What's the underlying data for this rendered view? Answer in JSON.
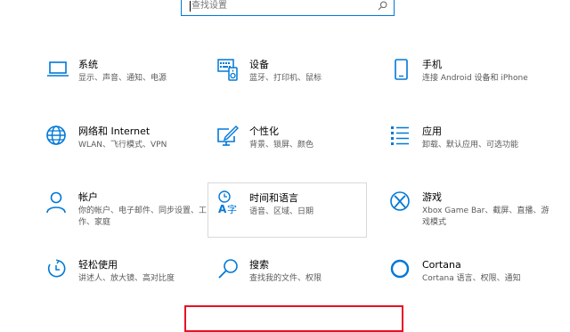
{
  "search": {
    "placeholder": "查找设置"
  },
  "tiles": [
    {
      "title": "系统",
      "desc": "显示、声音、通知、电源",
      "icon": "laptop-icon"
    },
    {
      "title": "设备",
      "desc": "蓝牙、打印机、鼠标",
      "icon": "devices-icon"
    },
    {
      "title": "手机",
      "desc": "连接 Android 设备和 iPhone",
      "icon": "phone-icon"
    },
    {
      "title": "网络和 Internet",
      "desc": "WLAN、飞行模式、VPN",
      "icon": "globe-icon"
    },
    {
      "title": "个性化",
      "desc": "背景、锁屏、颜色",
      "icon": "personalization-icon"
    },
    {
      "title": "应用",
      "desc": "卸载、默认应用、可选功能",
      "icon": "apps-list-icon"
    },
    {
      "title": "帐户",
      "desc": "你的帐户、电子邮件、同步设置、工作、家庭",
      "icon": "person-icon"
    },
    {
      "title": "时间和语言",
      "desc": "语音、区域、日期",
      "icon": "time-language-icon"
    },
    {
      "title": "游戏",
      "desc": "Xbox Game Bar、截屏、直播、游戏模式",
      "icon": "xbox-icon"
    },
    {
      "title": "轻松使用",
      "desc": "讲述人、放大镜、高对比度",
      "icon": "ease-of-access-icon"
    },
    {
      "title": "搜索",
      "desc": "查找我的文件、权限",
      "icon": "search-icon"
    },
    {
      "title": "Cortana",
      "desc": "Cortana 语言、权限、通知",
      "icon": "cortana-icon"
    }
  ],
  "colors": {
    "accent": "#0078d7",
    "highlight": "#e81123"
  }
}
